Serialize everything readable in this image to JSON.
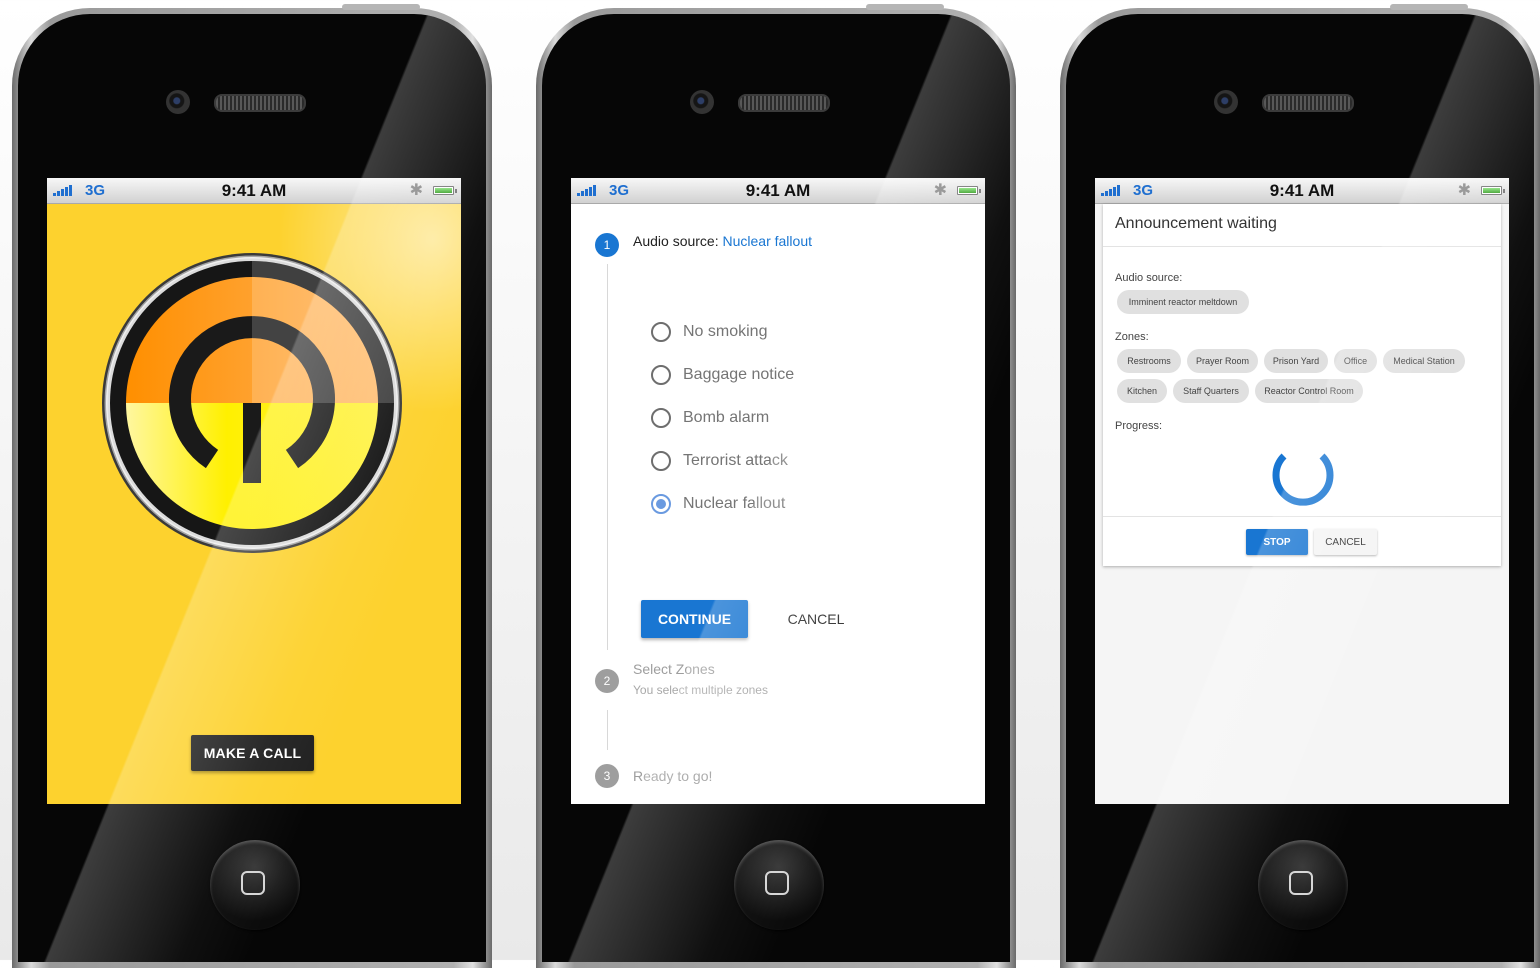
{
  "status_bar": {
    "network": "3G",
    "time": "9:41 AM",
    "bluetooth_icon": "bluetooth-icon",
    "battery_icon": "battery-icon"
  },
  "phone1": {
    "make_call_label": "MAKE A CALL"
  },
  "phone2": {
    "steps": [
      {
        "number": "1",
        "label": "Audio source:",
        "value": "Nuclear fallout"
      },
      {
        "number": "2",
        "label": "Select Zones",
        "sublabel": "You select multiple zones"
      },
      {
        "number": "3",
        "label": "Ready to go!"
      }
    ],
    "options": [
      {
        "label": "No smoking",
        "selected": false
      },
      {
        "label": "Baggage notice",
        "selected": false
      },
      {
        "label": "Bomb alarm",
        "selected": false
      },
      {
        "label": "Terrorist attack",
        "selected": false
      },
      {
        "label": "Nuclear fallout",
        "selected": true
      }
    ],
    "continue_label": "CONTINUE",
    "cancel_label": "CANCEL"
  },
  "phone3": {
    "title": "Announcement waiting",
    "audio_source_label": "Audio source:",
    "audio_source_value": "Imminent reactor meltdown",
    "zones_label": "Zones:",
    "zones": [
      "Restrooms",
      "Prayer Room",
      "Prison Yard",
      "Office",
      "Medical Station",
      "Kitchen",
      "Staff Quarters",
      "Reactor Control Room"
    ],
    "progress_label": "Progress:",
    "stop_label": "STOP",
    "cancel_label": "CANCEL"
  },
  "colors": {
    "accent": "#1976d2",
    "app_yellow": "#fdd22e"
  }
}
